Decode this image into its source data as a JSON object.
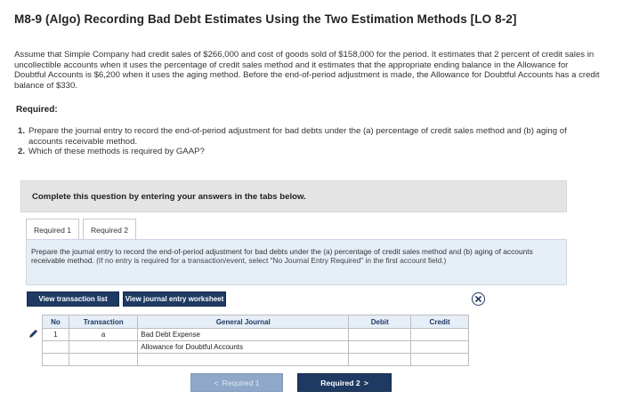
{
  "title": "M8-9 (Algo) Recording Bad Debt Estimates Using the Two Estimation Methods [LO 8-2]",
  "intro": "Assume that Simple Company had credit sales of $266,000 and cost of goods sold of $158,000 for the period. It estimates that 2 percent of credit sales in uncollectible accounts when it uses the percentage of credit sales method and it estimates that the appropriate ending balance in the Allowance for Doubtful Accounts is $6,200 when it uses the aging method. Before the end-of-period adjustment is made, the Allowance for Doubtful Accounts has a credit balance of $330.",
  "required_heading": "Required:",
  "requirements": [
    {
      "num": "1.",
      "text": "Prepare the journal entry to record the end-of-period adjustment for bad debts under the (a) percentage of credit sales method and (b) aging of accounts receivable method."
    },
    {
      "num": "2.",
      "text": "Which of these methods is required by GAAP?"
    }
  ],
  "complete_bar": "Complete this question by entering your answers in the tabs below.",
  "tabs": [
    "Required 1",
    "Required 2"
  ],
  "instruction": "Prepare the journal entry to record the end-of-period adjustment for bad debts under the (a) percentage of credit sales method and (b) aging of accounts receivable method.",
  "instruction_note": "(If no entry is required for a transaction/event, select \"No Journal Entry Required\" in the first account field.)",
  "buttons": {
    "view_transaction_list": "View transaction list",
    "view_journal_worksheet": "View journal entry worksheet"
  },
  "table": {
    "headers": [
      "No",
      "Transaction",
      "General Journal",
      "Debit",
      "Credit"
    ],
    "rows": [
      {
        "no": "1",
        "transaction": "a",
        "account": "Bad Debt Expense",
        "debit": "",
        "credit": ""
      },
      {
        "no": "",
        "transaction": "",
        "account": "Allowance for Doubtful Accounts",
        "debit": "",
        "credit": ""
      },
      {
        "no": "",
        "transaction": "",
        "account": "",
        "debit": "",
        "credit": ""
      }
    ]
  },
  "nav": {
    "prev": "Required 1",
    "next": "Required 2",
    "prev_arrow": "<",
    "next_arrow": ">"
  },
  "colors": {
    "navy": "#1e3a63",
    "panel_blue": "#e6eef7",
    "gray_bar": "#e4e4e4"
  }
}
